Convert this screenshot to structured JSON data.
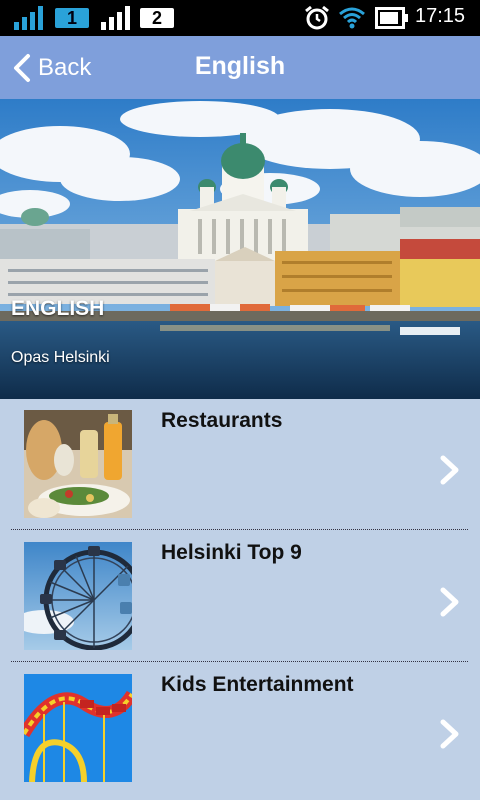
{
  "status_bar": {
    "sim1": "1",
    "sim2": "2",
    "time": "17:15",
    "icons": [
      "signal-icon",
      "signal-icon",
      "alarm-icon",
      "wifi-icon",
      "battery-icon"
    ]
  },
  "header": {
    "back_label": "Back",
    "title": "English"
  },
  "hero": {
    "title": "ENGLISH",
    "subtitle": "Opas Helsinki"
  },
  "list": {
    "items": [
      {
        "label": "Restaurants",
        "thumb": "restaurant-food-image"
      },
      {
        "label": "Helsinki Top 9",
        "thumb": "ferris-wheel-image"
      },
      {
        "label": "Kids Entertainment",
        "thumb": "roller-coaster-image"
      }
    ]
  },
  "colors": {
    "header_bg": "#7f9fdb",
    "list_bg": "#bfd0e6",
    "status_bg": "#000000",
    "sim1_badge": "#2aa2d9"
  }
}
